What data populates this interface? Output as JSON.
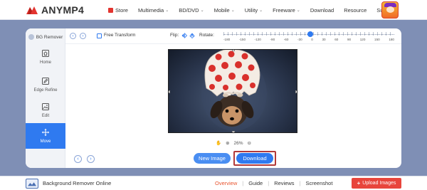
{
  "brand": {
    "name": "ANYMP4",
    "color": "#e3342f"
  },
  "nav": {
    "items": [
      {
        "label": "Store",
        "icon": "store-icon",
        "has_caret": false
      },
      {
        "label": "Multimedia",
        "has_caret": true
      },
      {
        "label": "BD/DVD",
        "has_caret": true
      },
      {
        "label": "Mobile",
        "has_caret": true
      },
      {
        "label": "Utility",
        "has_caret": true
      },
      {
        "label": "Freeware",
        "has_caret": true
      },
      {
        "label": "Download",
        "has_caret": false
      },
      {
        "label": "Resource",
        "has_caret": false
      },
      {
        "label": "Support",
        "has_caret": false
      }
    ],
    "caret": "⌄"
  },
  "sidebar": {
    "title": "BG Remover",
    "items": [
      {
        "label": "Home",
        "icon": "home-icon",
        "active": false
      },
      {
        "label": "Edge Refine",
        "icon": "pen-icon",
        "active": false
      },
      {
        "label": "Edit",
        "icon": "image-edit-icon",
        "active": false
      },
      {
        "label": "Move",
        "icon": "move-icon",
        "active": true
      }
    ]
  },
  "toolbar": {
    "undo": "‹",
    "redo": "›",
    "free_transform_label": "Free Transform",
    "free_transform_checked": false,
    "flip_label": "Flip:",
    "rotate_label": "Rotate:",
    "rotate_value": 0,
    "rotate_ticks": [
      "-180",
      "-150",
      "-120",
      "-90",
      "-60",
      "-30",
      "0",
      "30",
      "60",
      "90",
      "120",
      "150",
      "180"
    ]
  },
  "image": {
    "subject": "puppy-in-polka-dot-shell"
  },
  "zoom": {
    "value": "26%",
    "zoom_in": "⊕",
    "zoom_out": "⊖",
    "hand": "✋"
  },
  "actions": {
    "prev": "‹",
    "next": "›",
    "new_image": "New Image",
    "download": "Download"
  },
  "footer": {
    "title": "Background Remover Online",
    "links": [
      {
        "label": "Overview",
        "active": true
      },
      {
        "label": "Guide",
        "active": false
      },
      {
        "label": "Reviews",
        "active": false
      },
      {
        "label": "Screenshot",
        "active": false
      }
    ],
    "upload_label": "Upload Images",
    "upload_plus": "+"
  },
  "colors": {
    "accent": "#2f7af0",
    "background": "#7f8fb5",
    "upload": "#e8453c",
    "download_outline": "#b23a3a"
  }
}
